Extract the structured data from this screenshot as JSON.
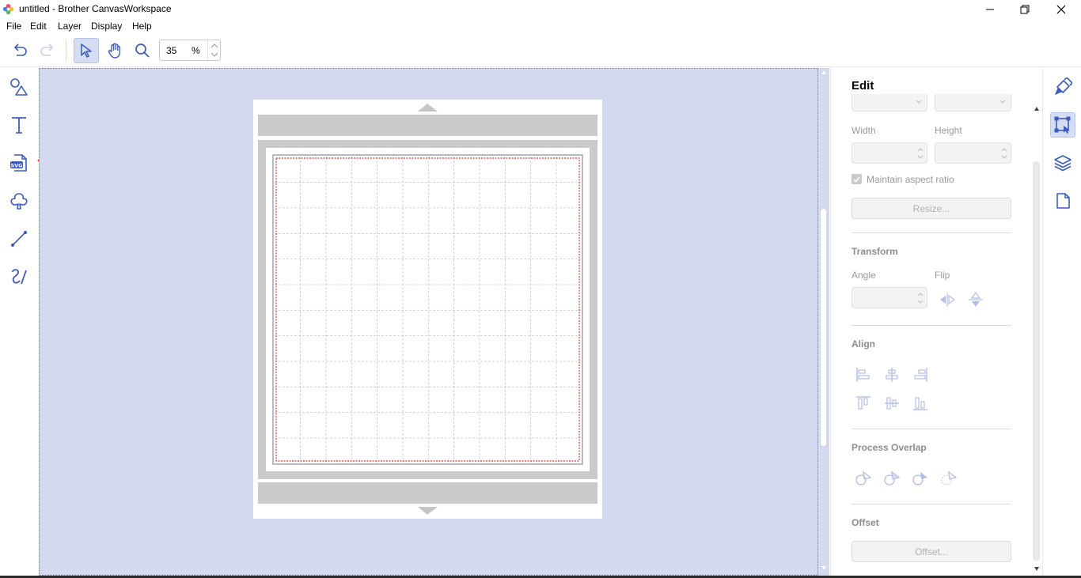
{
  "window": {
    "title": "untitled - Brother CanvasWorkspace"
  },
  "menu": [
    "File",
    "Edit",
    "Layer",
    "Display",
    "Help"
  ],
  "toolbar": {
    "zoom_value": "35",
    "zoom_unit": "%"
  },
  "left_tools": [
    {
      "icon": "shapes-icon"
    },
    {
      "icon": "text-icon"
    },
    {
      "icon": "svg-import-icon"
    },
    {
      "icon": "pattern-icon"
    },
    {
      "icon": "line-icon"
    },
    {
      "icon": "freehand-icon"
    }
  ],
  "edit_panel": {
    "title": "Edit",
    "width_label": "Width",
    "height_label": "Height",
    "maintain_aspect": "Maintain aspect ratio",
    "resize_button": "Resize...",
    "transform_title": "Transform",
    "angle_label": "Angle",
    "flip_label": "Flip",
    "align_title": "Align",
    "process_overlap_title": "Process Overlap",
    "offset_title": "Offset",
    "offset_button": "Offset..."
  },
  "right_tools": [
    {
      "icon": "paint-brush-icon",
      "active": false
    },
    {
      "icon": "edit-transform-icon",
      "active": true
    },
    {
      "icon": "layers-icon",
      "active": false
    },
    {
      "icon": "page-icon",
      "active": false
    }
  ],
  "colors": {
    "accent": "#3b5bbf",
    "canvas_bg": "#d3daef",
    "annotation_arrow": "#ff0000",
    "cut_line": "#d40000"
  }
}
